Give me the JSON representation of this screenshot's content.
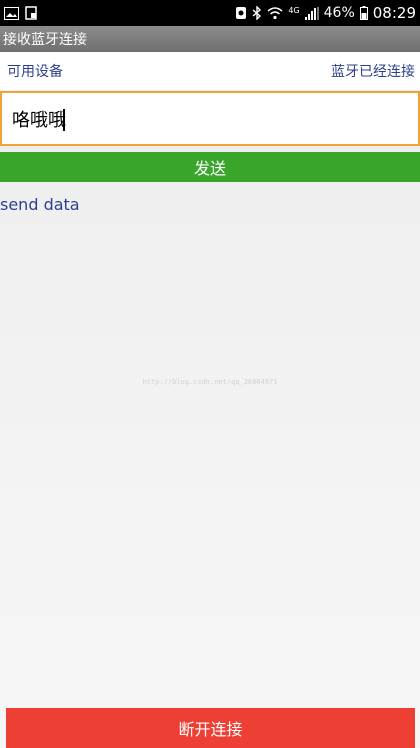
{
  "status_bar": {
    "icons_left": [
      "image-icon",
      "notification-icon"
    ],
    "icons_right": [
      "sync-icon",
      "bluetooth-icon",
      "wifi-icon",
      "signal-icon"
    ],
    "network": "4G",
    "battery": "46%",
    "time": "08:29"
  },
  "app": {
    "title": "接收蓝牙连接"
  },
  "links": {
    "available_devices": "可用设备",
    "bluetooth_connected": "蓝牙已经连接"
  },
  "input": {
    "value": "咯哦哦"
  },
  "buttons": {
    "send": "发送",
    "disconnect": "断开连接"
  },
  "received": {
    "text": "send data"
  },
  "watermark": "http://blog.csdn.net/qq_36864971",
  "colors": {
    "send_green": "#3aa52b",
    "disconnect_red": "#ee3f35",
    "input_border": "#f2a23a",
    "link_blue": "#2f3f8f"
  }
}
